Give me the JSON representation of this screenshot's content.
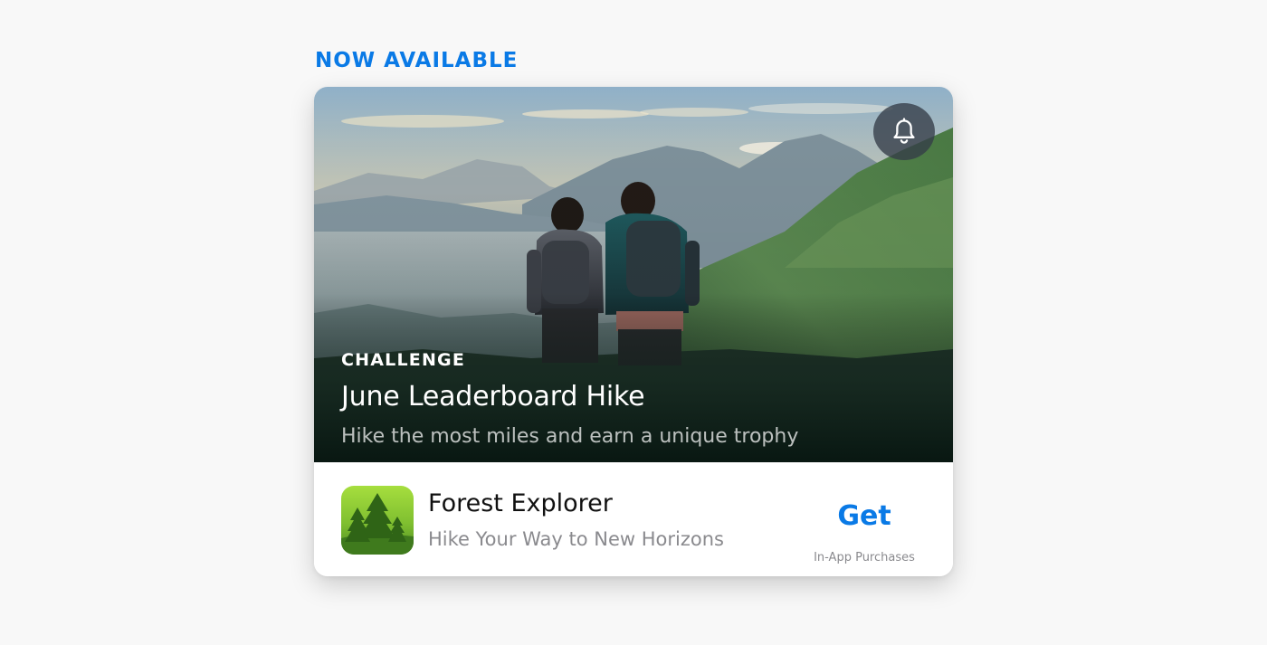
{
  "section": {
    "header": "NOW AVAILABLE"
  },
  "event": {
    "eyebrow": "CHALLENGE",
    "title": "June Leaderboard Hike",
    "subtitle": "Hike the most miles and earn a unique trophy",
    "notify_icon": "bell-icon"
  },
  "app": {
    "name": "Forest Explorer",
    "tagline": "Hike Your Way to New Horizons",
    "icon": "forest-trees-icon",
    "get_label": "Get",
    "purchase_note": "In-App Purchases"
  },
  "colors": {
    "accent": "#0a7ae6",
    "page_background": "#f8f8f8",
    "card_background": "#ffffff",
    "secondary_text": "#8a8a8e",
    "icon_green_top": "#9ed93a",
    "icon_green_bottom": "#4f8f22"
  }
}
